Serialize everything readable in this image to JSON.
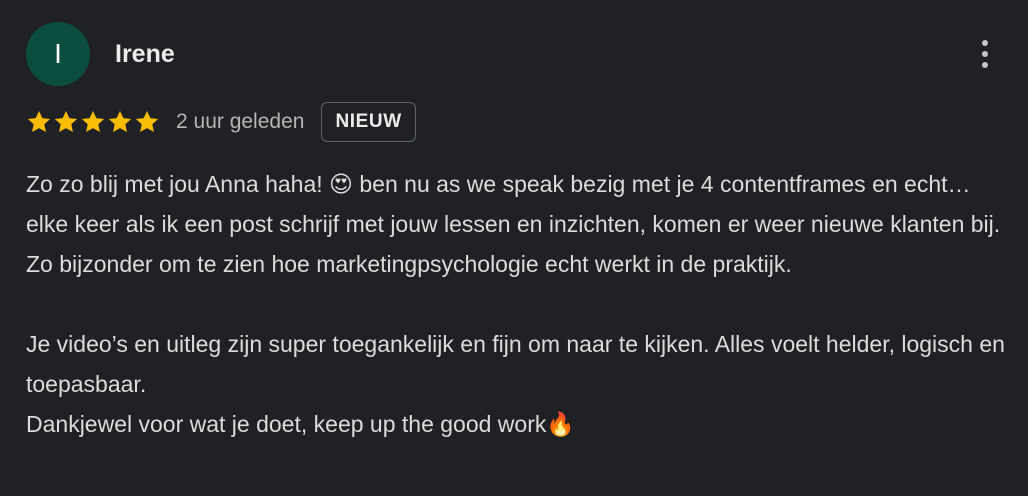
{
  "review": {
    "avatar_letter": "I",
    "avatar_color": "#0b4d3e",
    "reviewer_name": "Irene",
    "more_icon": "more-vertical-icon",
    "rating": 5,
    "rating_max": 5,
    "star_color": "#fbbc04",
    "time_ago": "2 uur geleden",
    "badge": "NIEUW",
    "paragraph_1": "Zo zo blij met jou Anna haha! 😍 ben nu as we speak bezig met je 4 contentframes en echt… elke keer als ik een post schrijf met jouw lessen en inzichten, komen er weer nieuwe klanten bij. Zo bijzonder om te zien hoe marketingpsychologie echt werkt in de praktijk.",
    "paragraph_2_line_1": "Je video’s en uitleg zijn super toegankelijk en fijn om naar te kijken. Alles voelt helder, logisch en toepasbaar.",
    "paragraph_2_line_2": "Dankjewel voor wat je doet, keep up the good work🔥"
  }
}
